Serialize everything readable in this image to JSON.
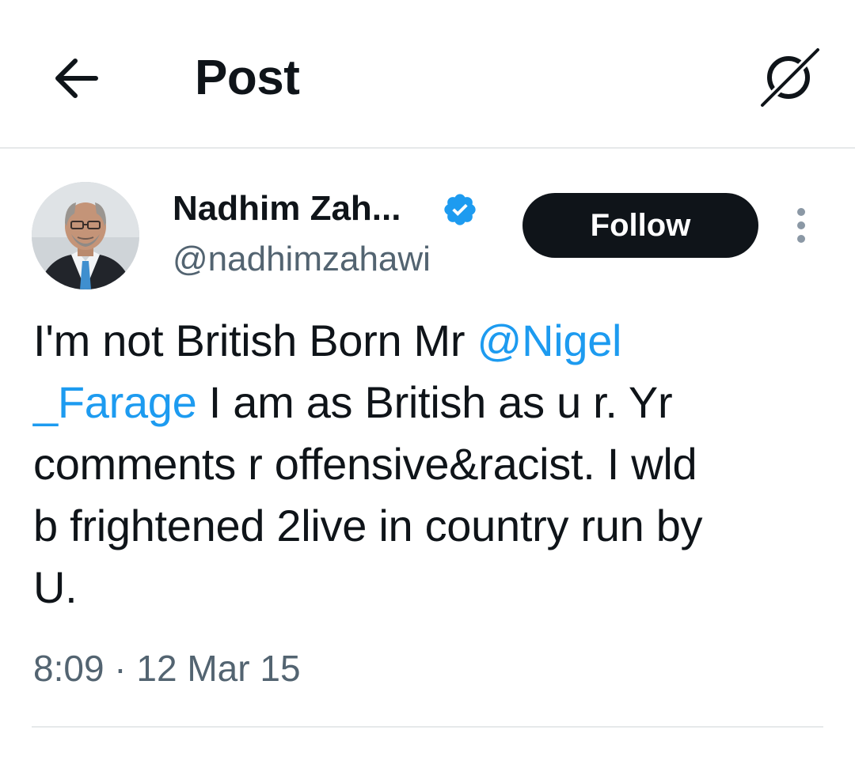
{
  "header": {
    "title": "Post",
    "back_icon": "arrow-left-icon",
    "grok_icon": "grok-icon"
  },
  "post": {
    "author_name": "Nadhim Zah...",
    "author_handle": "@nadhimzahawi",
    "verified": true,
    "verified_color": "#1d9bf0",
    "follow_label": "Follow",
    "more_icon": "more-vertical-icon",
    "text": {
      "line1_pre": "I'm not British Born Mr ",
      "line1_mention": "@Nigel",
      "line2_mention": "_Farage",
      "line2_post": " I am as British as u r. Yr",
      "line3": "comments r offensive&racist. I wld",
      "line4": "b frightened 2live in country run by",
      "line5": "U."
    },
    "timestamp": "8:09 · 12 Mar 15"
  },
  "colors": {
    "link": "#1d9bf0",
    "secondary_text": "#536471",
    "primary_text": "#0f1419",
    "button_bg": "#0f1419"
  }
}
